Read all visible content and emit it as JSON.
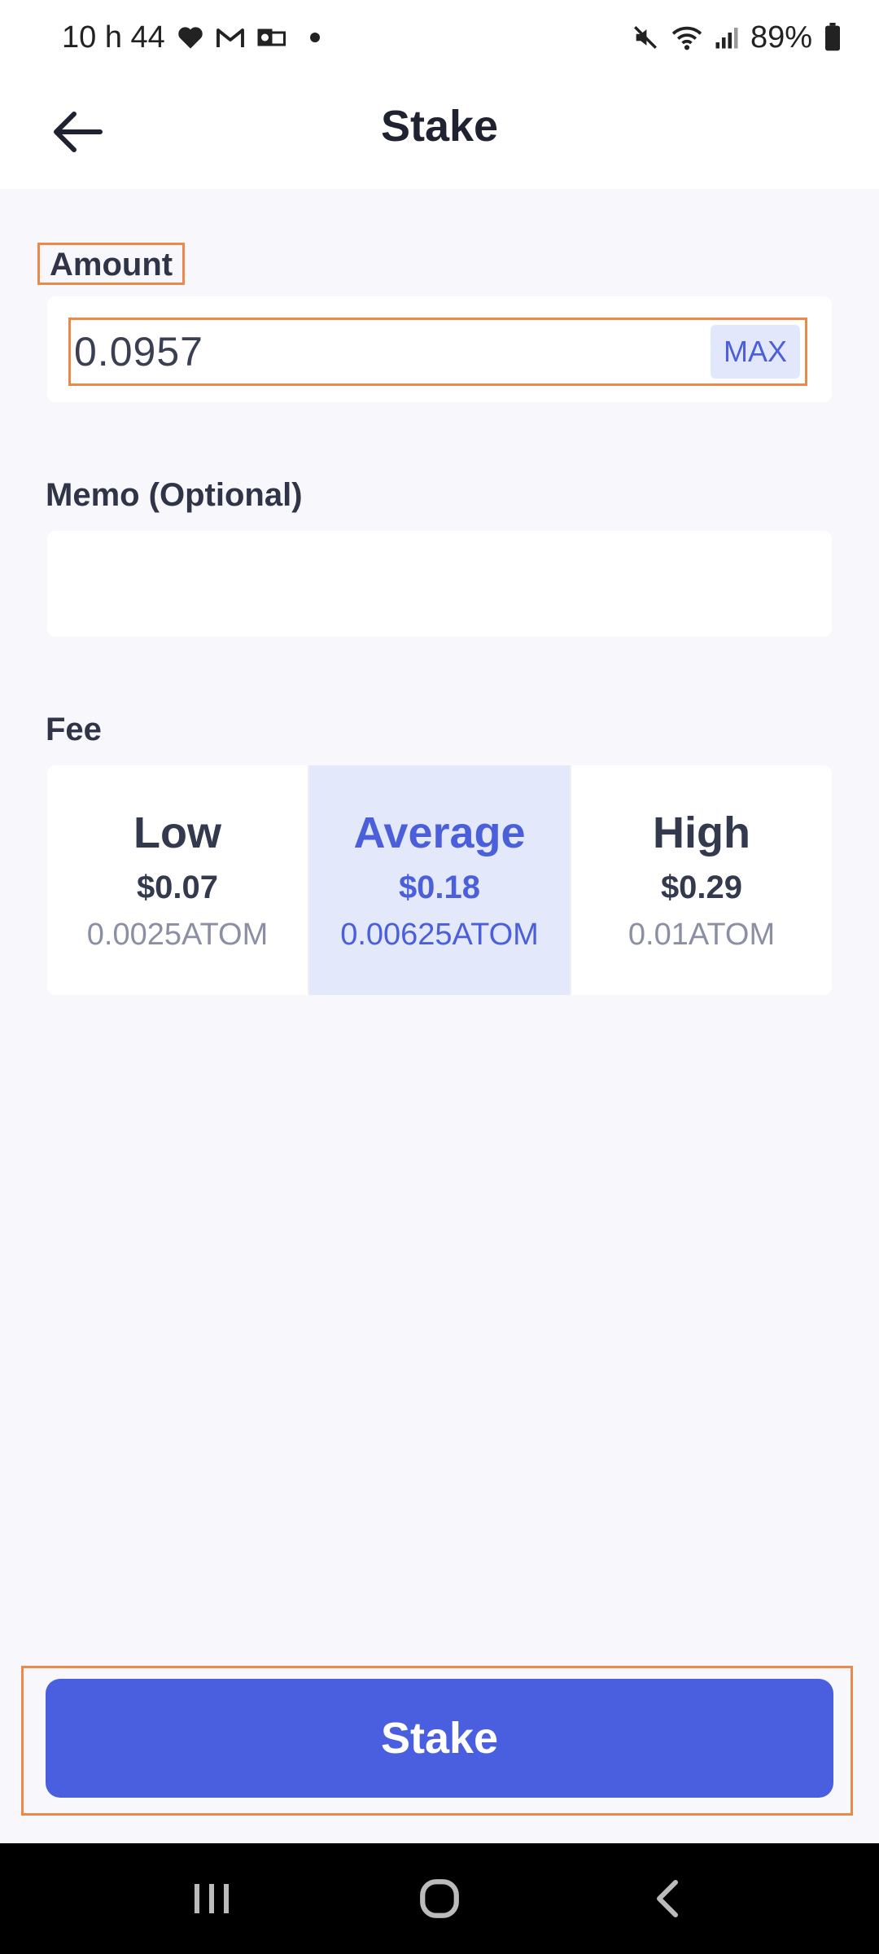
{
  "status_bar": {
    "time": "10 h 44",
    "battery": "89%",
    "icons": [
      "heart-icon",
      "gmail-icon",
      "outlook-icon",
      "dot-icon",
      "mute-icon",
      "wifi-icon",
      "signal-icon",
      "battery-icon"
    ]
  },
  "header": {
    "title": "Stake",
    "back_icon": "arrow-left-icon"
  },
  "form": {
    "amount_label": "Amount",
    "amount_value": "0.0957",
    "max_label": "MAX",
    "memo_label": "Memo (Optional)",
    "memo_value": "",
    "fee_label": "Fee",
    "fee_options": [
      {
        "name": "Low",
        "usd": "$0.07",
        "atom": "0.0025ATOM",
        "selected": false
      },
      {
        "name": "Average",
        "usd": "$0.18",
        "atom": "0.00625ATOM",
        "selected": true
      },
      {
        "name": "High",
        "usd": "$0.29",
        "atom": "0.01ATOM",
        "selected": false
      }
    ]
  },
  "action": {
    "stake_label": "Stake"
  },
  "nav_bar": {
    "icons": [
      "recent-apps-icon",
      "home-icon",
      "back-nav-icon"
    ]
  },
  "colors": {
    "accent": "#4a5fe0",
    "selected_fee_bg": "#e3e8fb",
    "highlight_outline": "#e98a4a",
    "page_bg": "#f7f7fc"
  }
}
